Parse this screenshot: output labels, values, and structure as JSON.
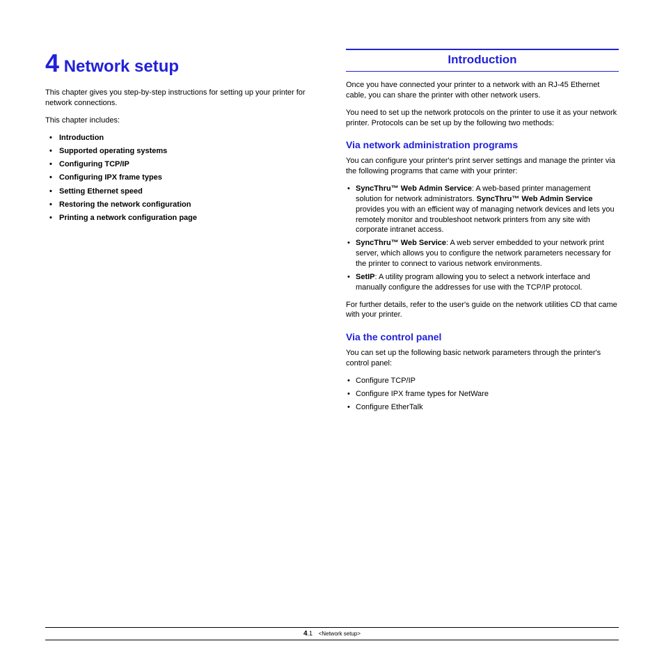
{
  "chapter": {
    "number": "4",
    "title": "Network setup",
    "intro": "This chapter gives you step-by-step instructions for setting up your printer for network connections.",
    "includes_label": "This chapter includes:",
    "toc": [
      "Introduction",
      "Supported operating systems",
      "Configuring TCP/IP",
      "Configuring IPX frame types",
      "Setting Ethernet speed",
      "Restoring the network configuration",
      "Printing a network configuration page"
    ]
  },
  "section": {
    "heading": "Introduction",
    "p1": "Once you have connected your printer to a network with an RJ-45 Ethernet cable, you can share the printer with other network users.",
    "p2": "You need to set up the network protocols on the printer to use it as your network printer. Protocols can be set up by the following two methods:",
    "sub1": {
      "heading": "Via network administration programs",
      "intro": "You can configure your printer's print server settings and manage the printer via the following programs that came with your printer:",
      "item1_bold1": "SyncThru™ Web Admin Service",
      "item1_mid": ": A web-based printer management solution for network administrators. ",
      "item1_bold2": "SyncThru™ Web Admin Service",
      "item1_end": " provides you with an efficient way of managing network devices and lets you remotely monitor and troubleshoot network printers from any site with corporate intranet access.",
      "item2_bold": "SyncThru™ Web Service",
      "item2_rest": ": A web server embedded to your network print server, which allows you to configure the network parameters necessary for the printer to connect to various network environments.",
      "item3_bold": "SetIP",
      "item3_rest": ": A utility program allowing you to select a network interface and manually configure the addresses for use with the TCP/IP protocol.",
      "outro": "For further details, refer to the user's guide on the network utilities CD that came with your printer."
    },
    "sub2": {
      "heading": "Via the control panel",
      "intro": "You can set up the following basic network parameters through the printer's control panel:",
      "items": [
        "Configure TCP/IP",
        "Configure IPX frame types for NetWare",
        "Configure EtherTalk"
      ]
    }
  },
  "footer": {
    "chapter_num": "4",
    "page_sep": ".",
    "page_num": "1",
    "chapter_label": "<Network setup>"
  }
}
